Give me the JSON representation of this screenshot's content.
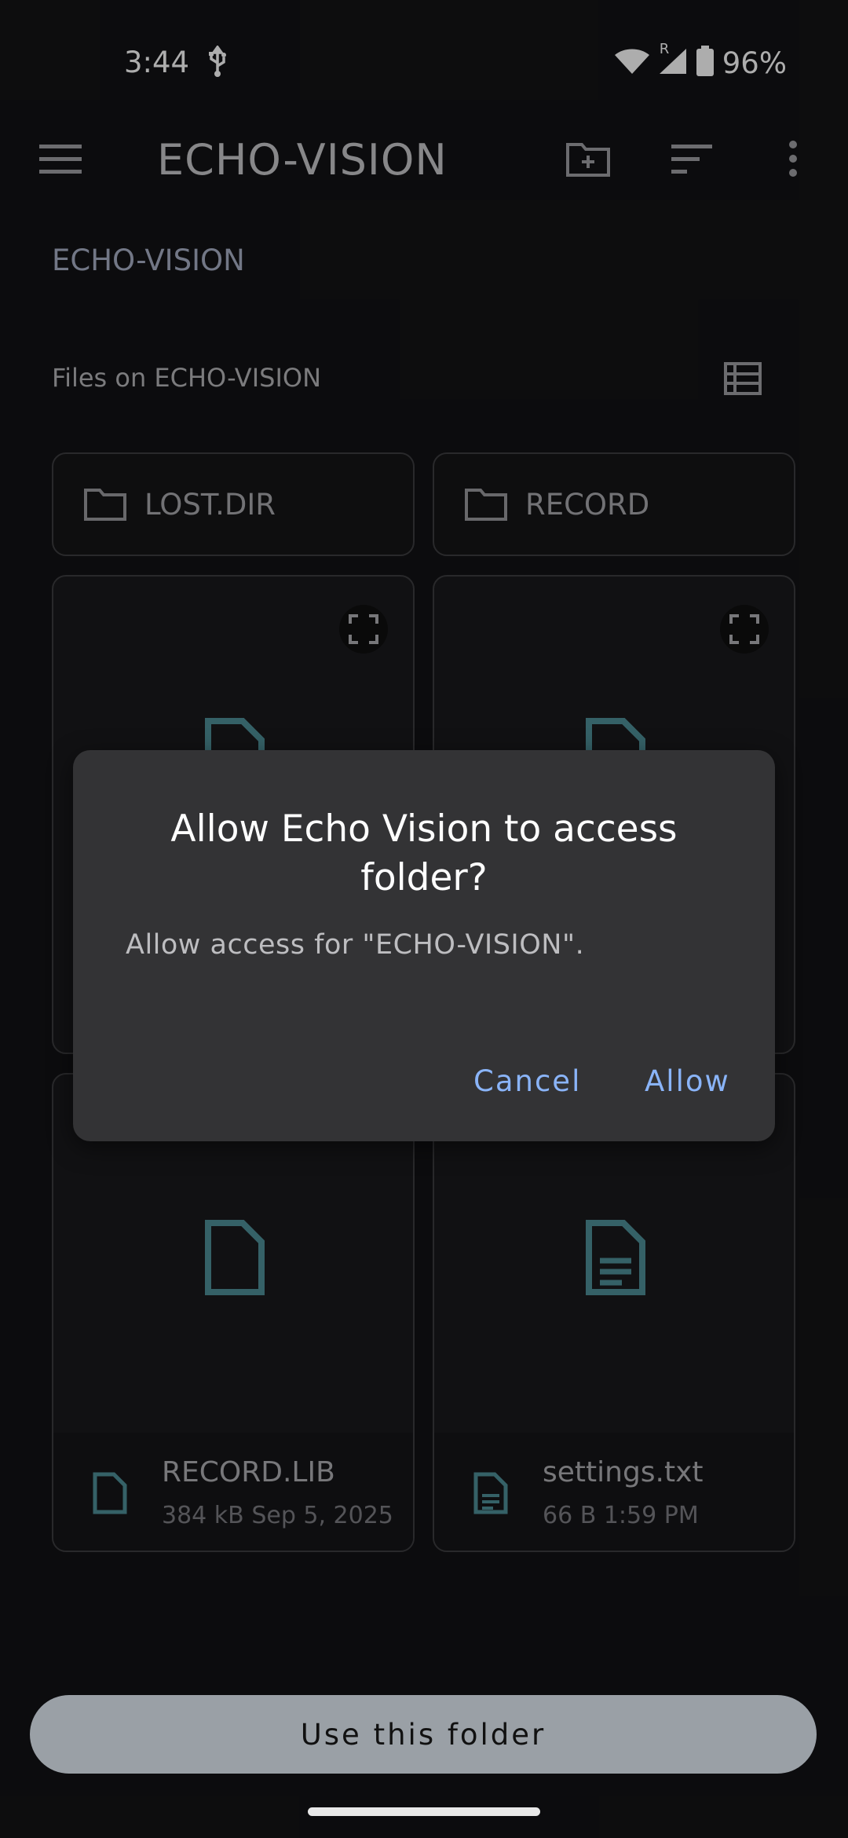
{
  "status": {
    "time": "3:44",
    "battery": "96%",
    "roaming": "R"
  },
  "appbar": {
    "title": "ECHO-VISION"
  },
  "breadcrumb": "ECHO-VISION",
  "section": {
    "title": "Files on ECHO-VISION"
  },
  "folders": [
    {
      "name": "LOST.DIR"
    },
    {
      "name": "RECORD"
    }
  ],
  "files": [
    {
      "name": "RECORD.LIB",
      "size": "384 kB",
      "date": "Sep 5, 2025"
    },
    {
      "name": "settings.txt",
      "size": "66 B",
      "date": "1:59 PM"
    }
  ],
  "dialog": {
    "title": "Allow Echo Vision to access folder?",
    "body": "Allow access for \"ECHO-VISION\".",
    "cancel": "Cancel",
    "allow": "Allow"
  },
  "bottom": {
    "use_folder": "Use this folder"
  },
  "colors": {
    "accent": "#8ab4f8",
    "file_icon": "#4e8f99",
    "background": "#131315"
  }
}
